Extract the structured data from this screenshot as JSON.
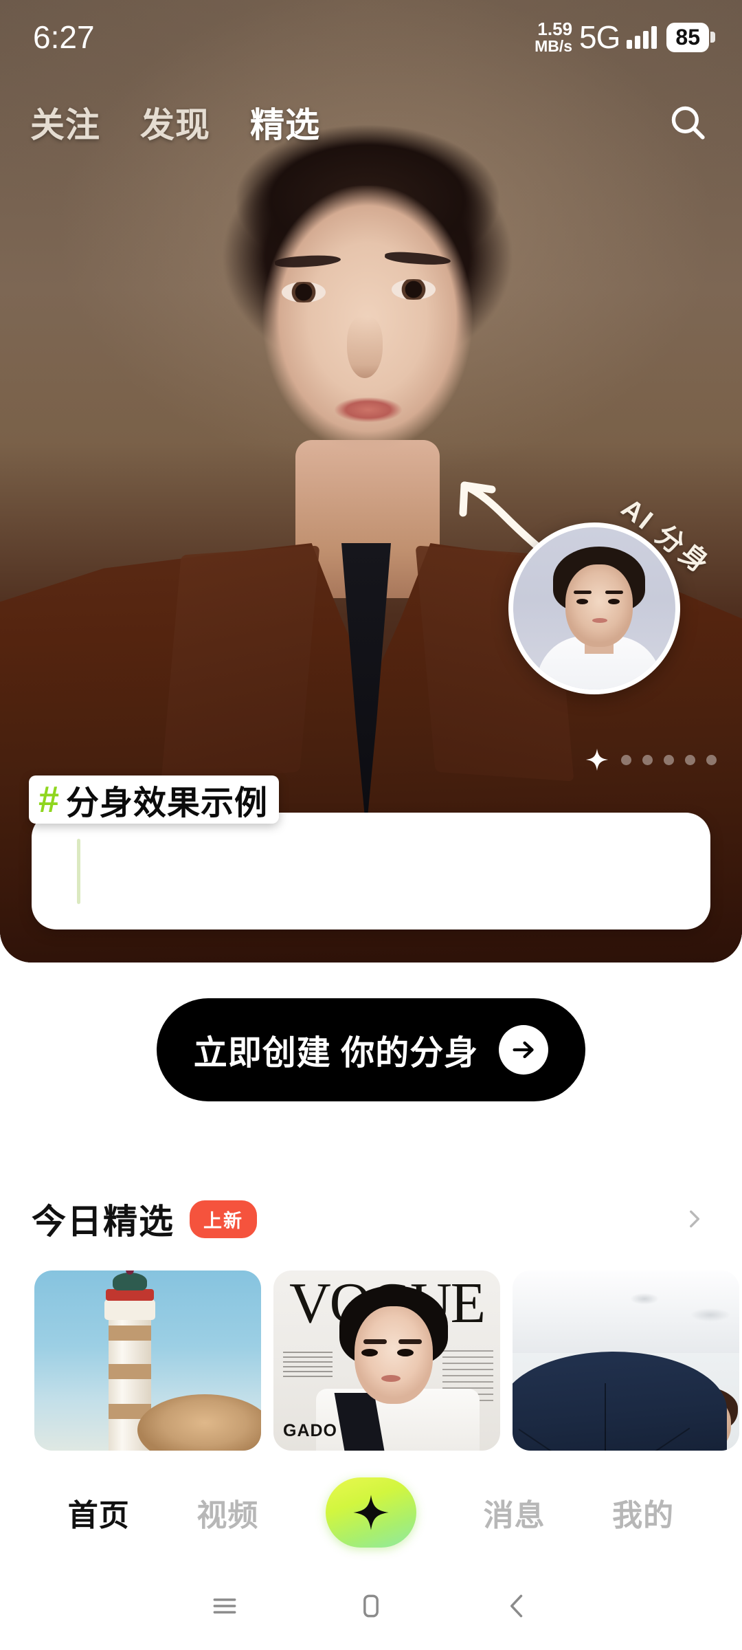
{
  "status_bar": {
    "time": "6:27",
    "net_speed_value": "1.59",
    "net_speed_unit": "MB/s",
    "network": "5G",
    "battery": "85",
    "signal_icon": "signal-bars-icon",
    "battery_icon": "battery-icon"
  },
  "top_tabs": {
    "items": [
      {
        "label": "关注",
        "active": false
      },
      {
        "label": "发现",
        "active": false
      },
      {
        "label": "精选",
        "active": true
      }
    ],
    "highlight_color": "#8fd61f",
    "search_icon": "search-icon"
  },
  "hero": {
    "ai_badge_label": "AI 分身",
    "arrow_icon": "curved-arrow-icon",
    "avatar_name": "ai-avatar-preview",
    "hashtag_symbol": "#",
    "hashtag_label": "分身效果示例",
    "hashtag_symbol_color": "#8fd61f",
    "carousel": {
      "active_icon": "sparkle-star-icon",
      "dot_count": 5,
      "active_index": 0
    }
  },
  "cta": {
    "label": "立即创建 你的分身",
    "arrow_icon": "arrow-right-icon",
    "background": "#000000"
  },
  "section": {
    "title": "今日精选",
    "badge": "上新",
    "badge_color": "#f5533d",
    "more_icon": "chevron-right-icon",
    "cards": [
      {
        "name": "lighthouse-card",
        "alt": "灯塔与草帽人像"
      },
      {
        "name": "vogue-card",
        "alt": "VOGUE 杂志封面",
        "masthead": "VOGUE",
        "brand": "GADO"
      },
      {
        "name": "umbrella-card",
        "alt": "雪地蓝伞人像"
      }
    ]
  },
  "bottom_nav": {
    "items": [
      {
        "label": "首页",
        "active": true
      },
      {
        "label": "视频",
        "active": false
      },
      {
        "label": "消息",
        "active": false
      },
      {
        "label": "我的",
        "active": false
      }
    ],
    "center_icon": "sparkle-star-icon",
    "center_gradient_start": "#e9f84f",
    "center_gradient_end": "#8fe9a2"
  },
  "system_nav": {
    "recents_icon": "recents-menu-icon",
    "home_icon": "home-square-icon",
    "back_icon": "back-chevron-icon"
  }
}
